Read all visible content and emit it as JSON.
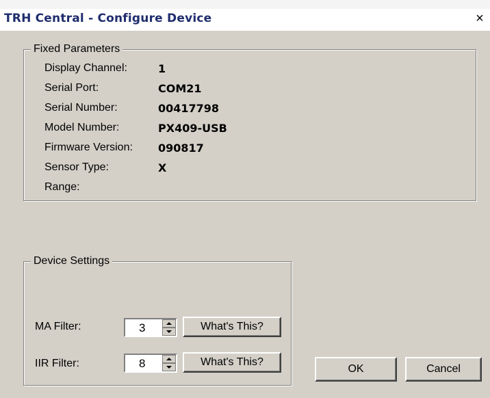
{
  "window": {
    "title": "TRH Central - Configure Device",
    "close_label": "×"
  },
  "fixed_parameters": {
    "title": "Fixed Parameters",
    "rows": [
      {
        "label": "Display Channel:",
        "value": "1"
      },
      {
        "label": "Serial Port:",
        "value": "COM21"
      },
      {
        "label": "Serial Number:",
        "value": "00417798"
      },
      {
        "label": "Model Number:",
        "value": "PX409-USB"
      },
      {
        "label": "Firmware Version:",
        "value": "090817"
      },
      {
        "label": "Sensor Type:",
        "value": "X"
      },
      {
        "label": "Range:",
        "value": ""
      }
    ]
  },
  "device_settings": {
    "title": "Device Settings",
    "ma_filter": {
      "label": "MA Filter:",
      "value": "3",
      "help_label": "What's This?"
    },
    "iir_filter": {
      "label": "IIR Filter:",
      "value": "8",
      "help_label": "What's This?"
    }
  },
  "buttons": {
    "ok_label": "OK",
    "cancel_label": "Cancel"
  }
}
